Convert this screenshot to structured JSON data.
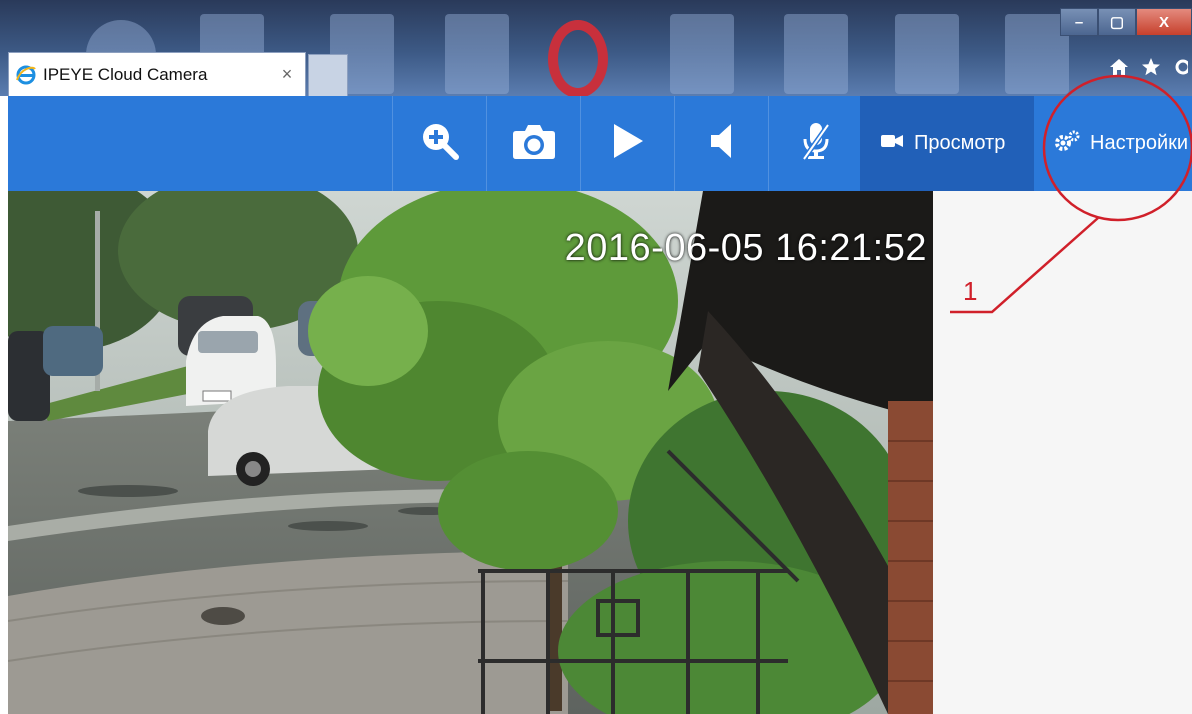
{
  "browser": {
    "tab_title": "IPEYE Cloud Camera",
    "tab_close": "×",
    "win_min": "–",
    "win_max": "▢",
    "win_close": "X"
  },
  "toolbar": {
    "view_label": "Просмотр",
    "settings_label": "Настройки",
    "colors": {
      "bar": "#2b79d9",
      "active": "#2160b8"
    }
  },
  "feed": {
    "timestamp": "2016-06-05  16:21:52"
  },
  "annotation": {
    "number": "1",
    "color": "#d0202a"
  }
}
